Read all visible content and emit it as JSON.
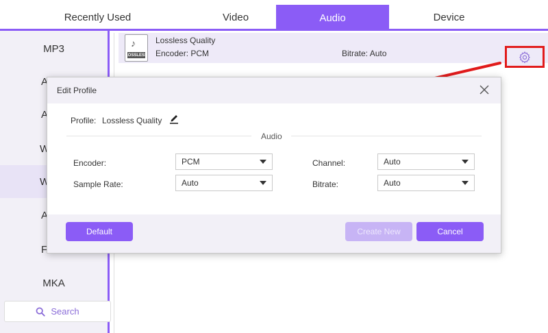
{
  "tabs": [
    "Recently Used",
    "Video",
    "Audio",
    "Device"
  ],
  "active_tab": "Audio",
  "sidebar": {
    "items": [
      "MP3",
      "A",
      "A",
      "W",
      "W",
      "A",
      "F",
      "MKA"
    ],
    "selected_index": 4,
    "search_label": "Search"
  },
  "profile_row": {
    "icon_badge": "LOSSLESS",
    "title": "Lossless Quality",
    "encoder": "Encoder: PCM",
    "bitrate": "Bitrate: Auto"
  },
  "modal": {
    "title": "Edit Profile",
    "profile_label": "Profile:",
    "profile_value": "Lossless Quality",
    "section_title": "Audio",
    "fields": {
      "encoder_label": "Encoder:",
      "encoder_value": "PCM",
      "sample_rate_label": "Sample Rate:",
      "sample_rate_value": "Auto",
      "channel_label": "Channel:",
      "channel_value": "Auto",
      "bitrate_label": "Bitrate:",
      "bitrate_value": "Auto"
    },
    "buttons": {
      "default": "Default",
      "create_new": "Create New",
      "cancel": "Cancel"
    }
  },
  "colors": {
    "accent": "#8b5cf6",
    "annotation": "#e11b1b",
    "panel_bg": "#f2f0f7"
  }
}
